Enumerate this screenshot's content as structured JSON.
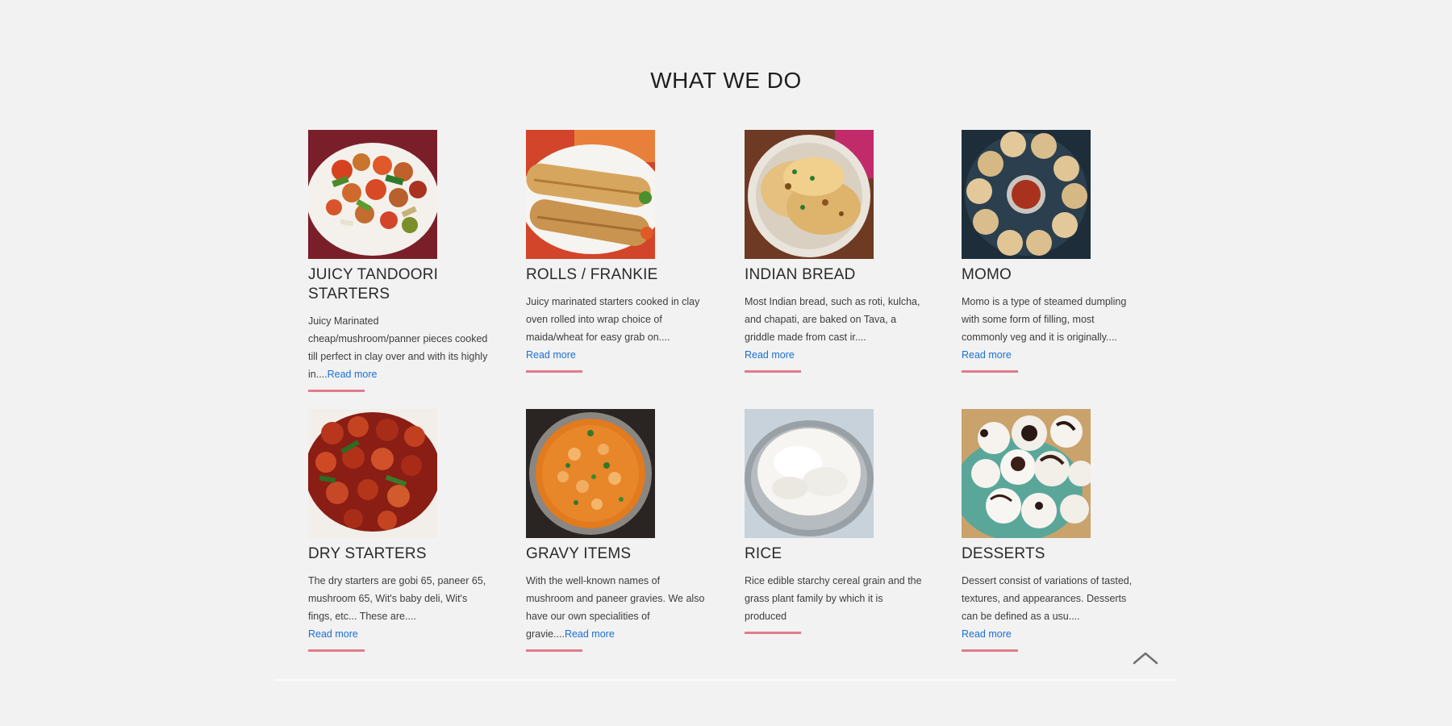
{
  "section": {
    "title": "WHAT WE DO"
  },
  "cards": [
    {
      "title": "JUICY TANDOORI STARTERS",
      "text": "Juicy Marinated cheap/mushroom/panner pieces cooked till perfect in clay over and with its highly in....",
      "read_more": "Read more"
    },
    {
      "title": "ROLLS / FRANKIE",
      "text": "Juicy marinated starters cooked in clay oven rolled into wrap choice of maida/wheat for easy grab on....",
      "read_more": "Read more"
    },
    {
      "title": "INDIAN BREAD",
      "text": "Most Indian bread, such as roti, kulcha, and chapati, are baked on Tava, a griddle made from cast ir....",
      "read_more": "Read more"
    },
    {
      "title": "MOMO",
      "text": "Momo is a type of steamed dumpling with some form of filling, most commonly veg and it is originally....",
      "read_more": "Read more"
    },
    {
      "title": "DRY STARTERS",
      "text": "The dry starters are gobi 65, paneer 65, mushroom 65, Wit's baby deli, Wit's fings, etc... These are....",
      "read_more": "Read more"
    },
    {
      "title": "GRAVY ITEMS",
      "text": "With the well-known names of mushroom and paneer gravies. We also have our own specialities of gravie....",
      "read_more": "Read more"
    },
    {
      "title": "RICE",
      "text": "Rice edible starchy cereal grain and the grass plant family by which it is produced",
      "read_more": ""
    },
    {
      "title": "DESSERTS",
      "text": "Dessert consist of variations of tasted, textures, and appearances. Desserts can be defined as a usu....",
      "read_more": "Read more"
    }
  ],
  "scroll_top": {
    "icon": "chevron-up-icon"
  }
}
